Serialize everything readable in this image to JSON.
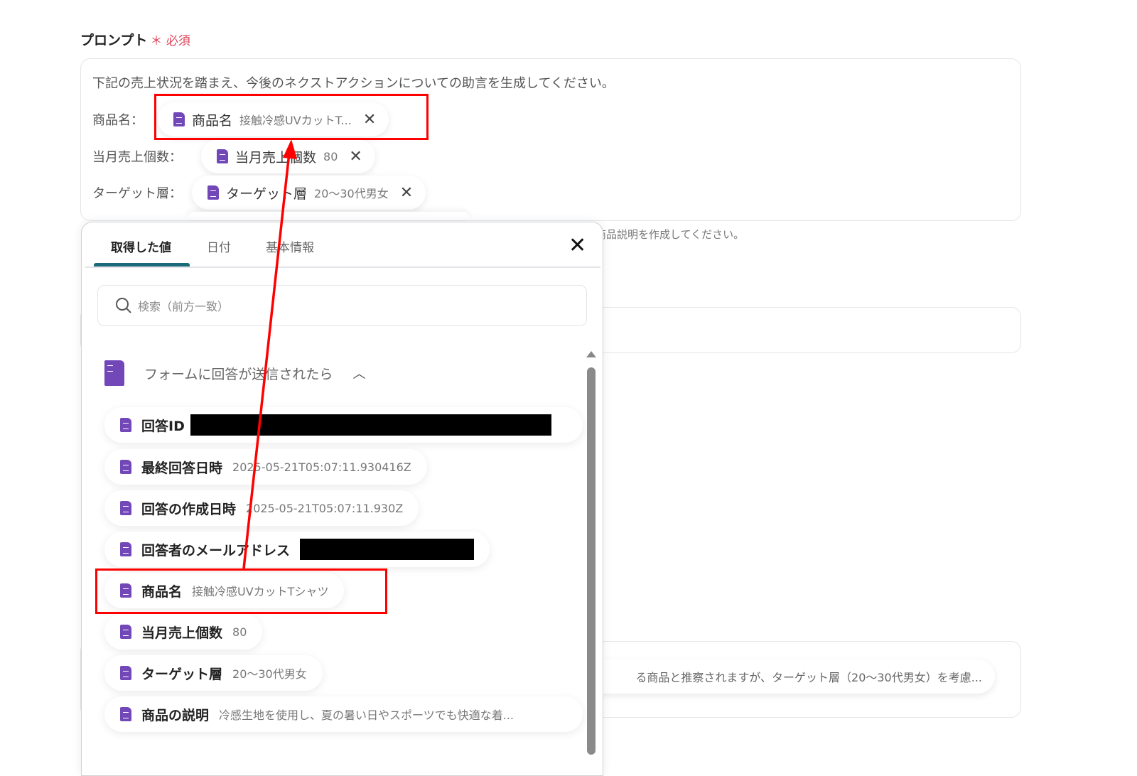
{
  "field": {
    "label": "プロンプト",
    "required_mark": "＊",
    "required_label": "必須"
  },
  "prompt": {
    "intro": "下記の売上状況を踏まえ、今後のネクストアクションについての助言を生成してください。",
    "rows": [
      {
        "label": "商品名：",
        "chip_key": "商品名",
        "chip_value": "接触冷感UVカットT..."
      },
      {
        "label": "当月売上個数：",
        "chip_key": "当月売上個数",
        "chip_value": "80"
      },
      {
        "label": "ターゲット層：",
        "chip_key": "ターゲット層",
        "chip_value": "20〜30代男女"
      }
    ]
  },
  "background": {
    "helper_text": "商品説明を作成してください。",
    "output_preview": "る商品と推察されますが、ターゲット層（20〜30代男女）を考慮..."
  },
  "popup": {
    "tabs": [
      "取得した値",
      "日付",
      "基本情報"
    ],
    "active_tab": 0,
    "search_placeholder": "検索（前方一致）",
    "group_title": "フォームに回答が送信されたら",
    "items": [
      {
        "key": "回答ID",
        "value": ""
      },
      {
        "key": "最終回答日時",
        "value": "2025-05-21T05:07:11.930416Z"
      },
      {
        "key": "回答の作成日時",
        "value": "2025-05-21T05:07:11.930Z"
      },
      {
        "key": "回答者のメールアドレス",
        "value": ""
      },
      {
        "key": "商品名",
        "value": "接触冷感UVカットTシャツ"
      },
      {
        "key": "当月売上個数",
        "value": "80"
      },
      {
        "key": "ターゲット層",
        "value": "20〜30代男女"
      },
      {
        "key": "商品の説明",
        "value": "冷感生地を使用し、夏の暑い日やスポーツでも快適な着..."
      }
    ]
  },
  "colors": {
    "accent_tab": "#1a6a7a",
    "doc_icon": "#7248b9",
    "annotation": "#ff0000",
    "required": "#e0435a"
  }
}
